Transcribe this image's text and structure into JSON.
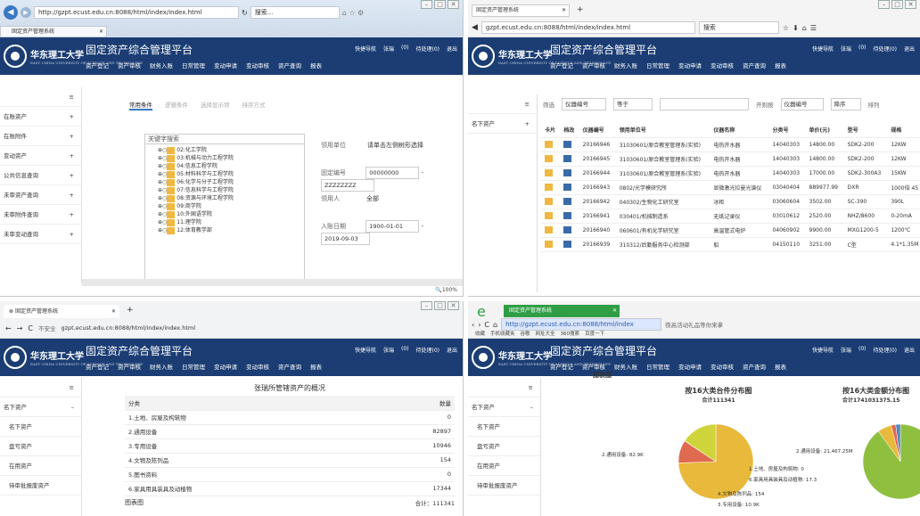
{
  "q1": {
    "url": "http://gzpt.ecust.edu.cn:8088/html/index/index.html",
    "search": "搜索...",
    "tab": "固定资产管理系统",
    "zoom": "100%",
    "tabs": [
      "常用条件",
      "逻辑条件",
      "选择显示项",
      "排序方式"
    ],
    "side": [
      "在账资产",
      "在账附件",
      "变动资产",
      "公共信息查询",
      "未审资产查询",
      "未审附件查询",
      "未审变动查询"
    ],
    "tree_label": "关键字搜索",
    "tree": [
      "02:化工学院",
      "03:机械与动力工程学院",
      "04:信息工程学院",
      "05:材料科学与工程学院",
      "06:化学与分子工程学院",
      "07:信息科学与工程学院",
      "08:资源与环境工程学院",
      "09:商学院",
      "10:外国语学院",
      "11:理学院",
      "12:体育教学部"
    ],
    "form": {
      "unit_label": "领用单位",
      "unit_val": "请单击左侧树形选择",
      "code_label": "固定编号",
      "code_from": "00000000",
      "code_to": "ZZZZZZZZ",
      "user_label": "领用人",
      "user_val": "全部",
      "date_label": "入账日期",
      "date_from": "1900-01-01",
      "date_to": "2019-09-03"
    }
  },
  "app": {
    "school": "华东理工大学",
    "school_en": "EAST CHINA UNIVERSITY OF SCIENCE AND TECHNOLOGY",
    "title": "固定资产综合管理平台",
    "links": [
      "快捷导航",
      "张瑞",
      "(0)",
      "待处理(0)",
      "退出"
    ],
    "nav": [
      "资产登记",
      "资产审核",
      "财务入账",
      "日常管理",
      "变动申请",
      "变动审核",
      "资产查询",
      "报表"
    ]
  },
  "q2": {
    "tab": "固定资产管理系统",
    "url": "gzpt.ecust.edu.cn:8088/html/index/index.html",
    "search": "搜索",
    "filter": {
      "field": "仪器编号",
      "op": "等于",
      "sort_label": "开则按",
      "sort_field": "仪器编号",
      "order": "降序",
      "order2": "排列"
    },
    "side": "名下资产",
    "cols": [
      "卡片",
      "档改",
      "仪器编号",
      "领用单位号",
      "仪器名称",
      "分类号",
      "单价(元)",
      "型号",
      "规格"
    ],
    "rows": [
      [
        "20166946",
        "31030601/原合教室管理系(实验)",
        "电热开水器",
        "14040303",
        "14800.00",
        "SDK2-200",
        "12KW"
      ],
      [
        "20166945",
        "31030601/原合教室管理系(实验)",
        "电热开水器",
        "14040303",
        "14800.00",
        "SDK2-200",
        "12KW"
      ],
      [
        "20166944",
        "31030601/原合教室管理系(实验)",
        "电热开水器",
        "14040303",
        "17000.00",
        "SDK2-300A3",
        "15KW"
      ],
      [
        "20166943",
        "0802/光学模研究所",
        "显微激光拉曼光谱仪",
        "03040404",
        "889977.99",
        "DXR",
        "1000倍 45"
      ],
      [
        "20166942",
        "040302/生物化工研究室",
        "冰柜",
        "03060604",
        "3502.00",
        "SC-390",
        "390L"
      ],
      [
        "20166941",
        "030401/机械制造系",
        "无纸记录仪",
        "03010612",
        "2520.00",
        "NHZ/8600",
        "0-20mA"
      ],
      [
        "20166940",
        "060601/有机化学研究室",
        "高温管式电炉",
        "04060902",
        "9900.00",
        "MXG1200-5",
        "1200℃"
      ],
      [
        "20166939",
        "310312/后勤服务中心检测部",
        "船",
        "04150110",
        "3251.00",
        "C型",
        "4.1*1.35M"
      ]
    ]
  },
  "q3": {
    "tab": "固定资产管理系统",
    "insecure": "不安全",
    "url": "gzpt.ecust.edu.cn:8088/html/index/index.html",
    "side": [
      "名下资产",
      "名下资产",
      "盘亏资产",
      "在用资产",
      "待审批报废资产"
    ],
    "table_title": "张瑞所管辖资产的概况",
    "col1": "分类",
    "col2": "数量",
    "rows": [
      [
        "1.土地、房屋及构筑物",
        "0"
      ],
      [
        "2.通用设备",
        "82897"
      ],
      [
        "3.专用设备",
        "10946"
      ],
      [
        "4.文物及陈列品",
        "154"
      ],
      [
        "5.图书资料",
        "0"
      ],
      [
        "6.家具用具装具及动植物",
        "17344"
      ]
    ],
    "total": "合计：111341",
    "chart_label": "图表图"
  },
  "q4": {
    "tab": "固定资产管理系统",
    "url": "http://gzpt.ecust.edu.cn:8088/html/index",
    "search": "筷高活动礼品等你来拿",
    "bookmarks": [
      "收藏",
      "手机收藏夹",
      "谷歌",
      "网址大全",
      "360搜索",
      "百度一下"
    ],
    "side": [
      "名下资产",
      "名下资产",
      "盘亏资产",
      "在用资产",
      "待审批报废资产"
    ],
    "chart_label": "图表图",
    "pie1_title": "按16大类台件分布图",
    "pie1_sub": "合计111341",
    "pie2_title": "按16大类金额分布图",
    "pie2_sub": "合计1741031375.15",
    "pie1_labels": [
      "2.通用设备: 82.9K",
      "1.土地、房屋及构筑物: 0",
      "6.家具用具装具及动植物: 17.3",
      "4.文物及陈列品: 154",
      "3.专用设备: 10.9K"
    ],
    "pie2_labels": [
      "2.通用设备: 21,467.25M"
    ]
  },
  "colors": {
    "header": "#1b3d74",
    "accent": "#3a78c3",
    "folder": "#f0b840"
  }
}
